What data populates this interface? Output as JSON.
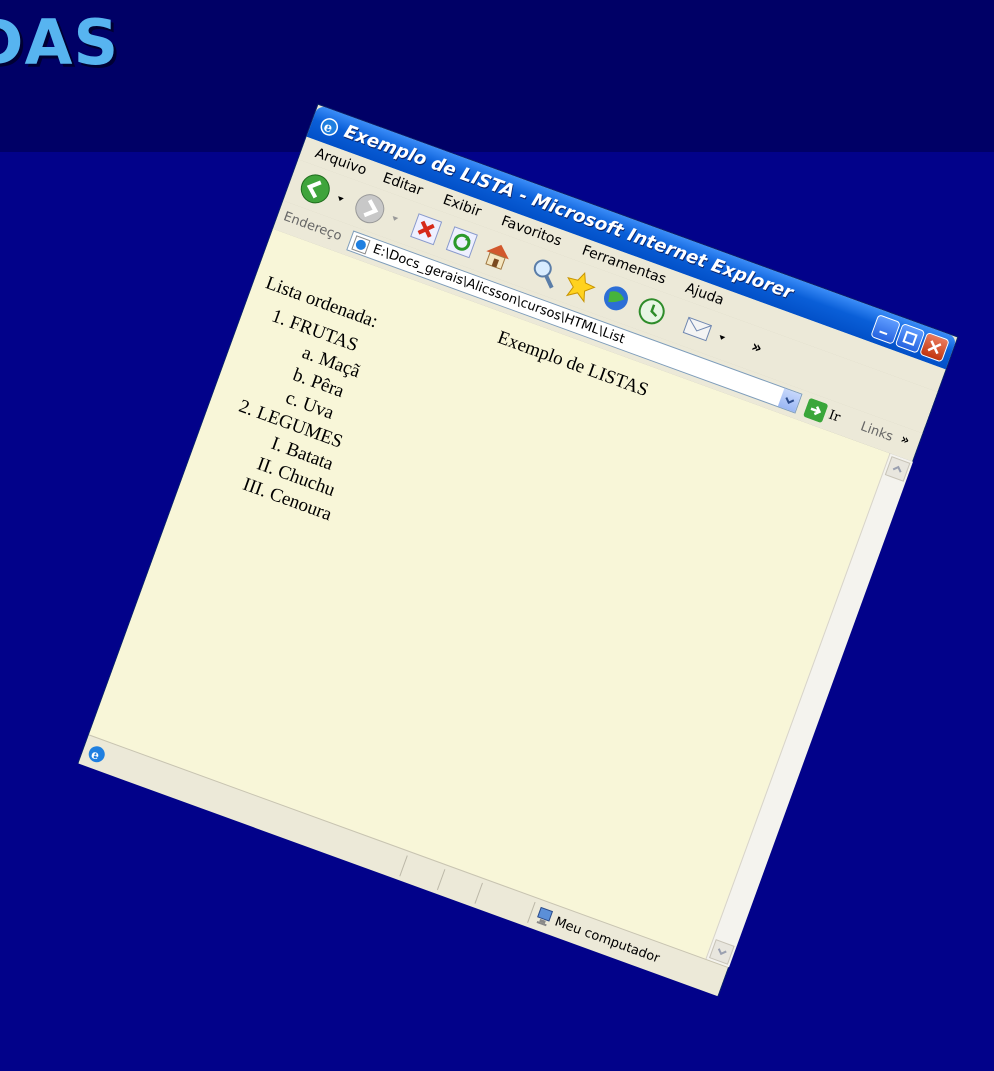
{
  "slide": {
    "title_fragment": "DAS"
  },
  "window": {
    "title": "Exemplo de LISTA - Microsoft Internet Explorer"
  },
  "menu": {
    "items": [
      "Arquivo",
      "Editar",
      "Exibir",
      "Favoritos",
      "Ferramentas",
      "Ajuda"
    ]
  },
  "toolbar": {
    "buttons": [
      "back-icon",
      "forward-icon",
      "stop-icon",
      "refresh-icon",
      "home-icon",
      "search-icon",
      "favorites-icon",
      "media-icon",
      "history-icon",
      "mail-icon"
    ],
    "overflow": "»"
  },
  "address": {
    "label": "Endereço",
    "value": "E:\\Docs_gerais\\Alicsson\\cursos\\HTML\\List",
    "go_label": "Ir",
    "links_label": "Links",
    "links_overflow": "»"
  },
  "page": {
    "heading": "Exemplo de LISTAS",
    "intro": "Lista ordenada:",
    "groups": [
      {
        "label": "FRUTAS",
        "items": [
          "Maçã",
          "Pêra",
          "Uva"
        ]
      },
      {
        "label": "LEGUMES",
        "items": [
          "Batata",
          "Chuchu",
          "Cenoura"
        ]
      }
    ]
  },
  "status": {
    "zone_text": "Meu computador"
  },
  "colors": {
    "slide_background": "#02027e",
    "title_color": "#57b4f0",
    "page_background": "#f8f6d8",
    "titlebar_blue": "#0a5fd8"
  }
}
